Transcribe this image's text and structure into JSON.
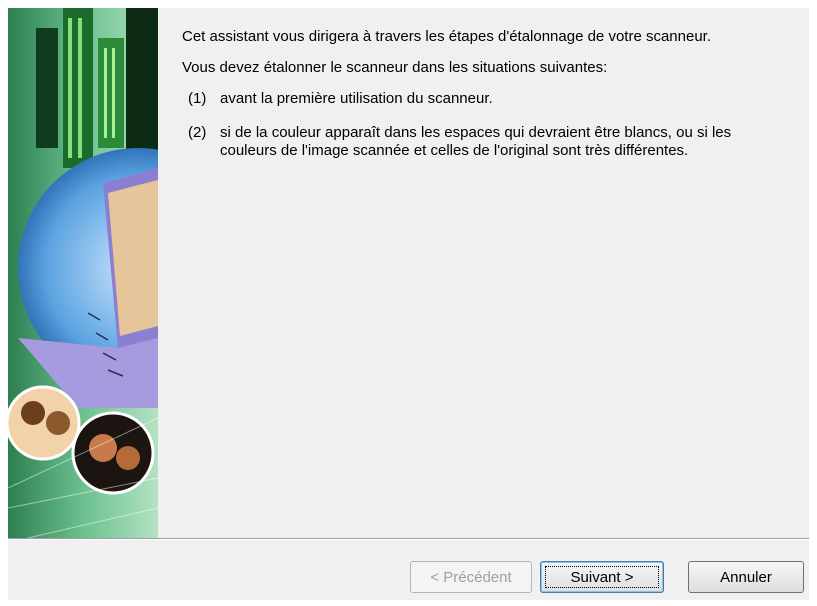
{
  "intro": {
    "paragraph1": "Cet assistant vous dirigera à travers les étapes d'étalonnage de votre scanneur.",
    "paragraph2": "Vous devez étalonner le scanneur dans les situations suivantes:"
  },
  "conditions": [
    {
      "number": "(1)",
      "text": "avant la première utilisation du scanneur."
    },
    {
      "number": "(2)",
      "text": "si de la couleur apparaît dans les espaces qui devraient être blancs, ou si les couleurs de l'image scannée et celles de l'original sont très différentes."
    }
  ],
  "buttons": {
    "previous": "< Précédent",
    "next": "Suivant >",
    "cancel": "Annuler"
  },
  "colors": {
    "dialog_background": "#f0f0f0",
    "side_art_green": "#5cb787",
    "laptop_purple": "#9a8fd6"
  },
  "icons": {
    "side_art": "wizard-banner-image"
  }
}
